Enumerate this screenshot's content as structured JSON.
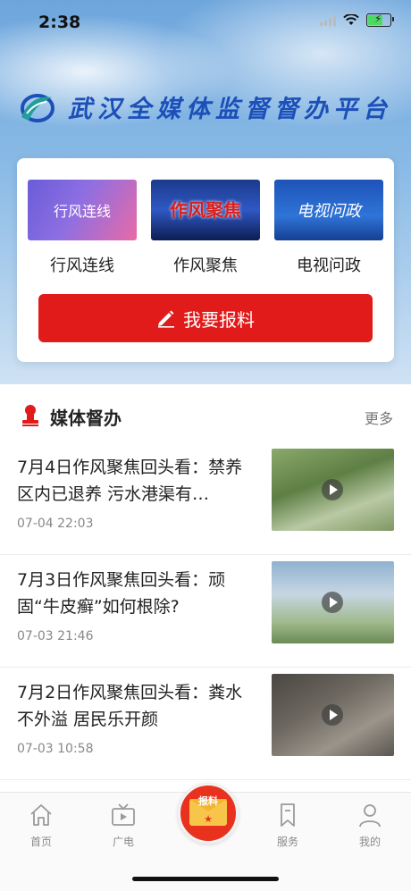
{
  "status": {
    "time": "2:38"
  },
  "brand": {
    "title": "武汉全媒体监督督办平台"
  },
  "channels": [
    {
      "label": "行风连线",
      "thumb_text": "行风连线"
    },
    {
      "label": "作风聚焦",
      "thumb_text": "作风聚焦"
    },
    {
      "label": "电视问政",
      "thumb_text": "电视问政"
    }
  ],
  "report_button": {
    "label": "我要报料"
  },
  "section": {
    "title": "媒体督办",
    "more": "更多"
  },
  "news": [
    {
      "title": "7月4日作风聚焦回头看：禁养区内已退养 污水港渠有…",
      "time": "07-04 22:03"
    },
    {
      "title": "7月3日作风聚焦回头看：顽固“牛皮癣”如何根除?",
      "time": "07-03 21:46"
    },
    {
      "title": "7月2日作风聚焦回头看：粪水不外溢 居民乐开颜",
      "time": "07-03 10:58"
    }
  ],
  "tabs": [
    {
      "label": "首页",
      "icon": "house-icon"
    },
    {
      "label": "广电",
      "icon": "tv-icon"
    },
    {
      "label": "报料",
      "icon": "envelope-icon"
    },
    {
      "label": "服务",
      "icon": "bookmark-icon"
    },
    {
      "label": "我的",
      "icon": "person-icon"
    }
  ],
  "colors": {
    "accent": "#e11a1a",
    "brand": "#1c4fb8"
  }
}
